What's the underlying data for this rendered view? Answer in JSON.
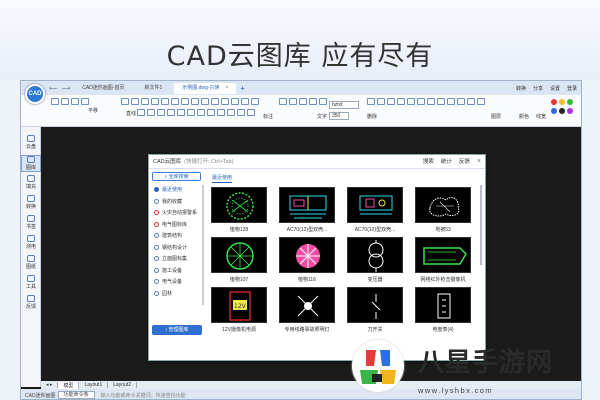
{
  "headline": "CAD云图库  应有尽有",
  "app": {
    "logo": "CAD",
    "tabs": [
      {
        "label": "CAD迷你画图-首页",
        "active": false
      },
      {
        "label": "新文件1",
        "active": false
      },
      {
        "label": "示例图.dwg-只读",
        "active": true
      }
    ],
    "add_tab": "+",
    "topright": [
      "转换",
      "分享",
      "设置",
      "登录"
    ],
    "ribbon": {
      "groups": [
        "平移",
        "直线",
        "标注",
        "文字",
        "删除",
        "图层",
        "颜色",
        "线宽"
      ],
      "font_value": "hztxt",
      "size_value": "350"
    },
    "leftbar": [
      {
        "label": "云盘",
        "active": false
      },
      {
        "label": "图库",
        "active": true
      },
      {
        "label": "填充",
        "active": false
      },
      {
        "label": "转换",
        "active": false
      },
      {
        "label": "书签",
        "active": false
      },
      {
        "label": "测电",
        "active": false
      },
      {
        "label": "图纸",
        "active": false
      },
      {
        "label": "工具",
        "active": false
      },
      {
        "label": "反馈",
        "active": false
      }
    ],
    "layout_tabs": [
      {
        "label": "模型",
        "active": true
      },
      {
        "label": "Layout1",
        "active": false
      },
      {
        "label": "Layout2",
        "active": false
      }
    ],
    "status": {
      "app_name": "CAD迷你画图",
      "cmd_button": "功能命令条",
      "hint": "输入功能或命令关键词，快速查找功能"
    }
  },
  "dialog": {
    "title": "CAD云图库",
    "subtitle": "(快捷打开: Ctrl+Tab)",
    "tools": [
      "搜索",
      "统计",
      "反馈"
    ],
    "search_button": "全库搜索",
    "recent_tab": "最近使用",
    "categories": [
      {
        "label": "最近使用",
        "active": true,
        "red": false
      },
      {
        "label": "我的收藏",
        "active": false,
        "red": false
      },
      {
        "label": "火灾自动报警系",
        "active": false,
        "red": true
      },
      {
        "label": "电气图标库",
        "active": false,
        "red": true
      },
      {
        "label": "建筑结构",
        "active": false,
        "red": false
      },
      {
        "label": "钢结构设计",
        "active": false,
        "red": false
      },
      {
        "label": "立面图标集",
        "active": false,
        "red": false
      },
      {
        "label": "施工设备",
        "active": false,
        "red": false
      },
      {
        "label": "电气设备",
        "active": false,
        "red": false
      },
      {
        "label": "园林",
        "active": false,
        "red": false
      }
    ],
    "manage_button": "管理图库",
    "items": [
      {
        "caption": "植物128",
        "icon": "plant-icon"
      },
      {
        "caption": "AC70(12)型双壳...",
        "icon": "conveyor-icon"
      },
      {
        "caption": "AC70(12)型双壳...",
        "icon": "conveyor-icon"
      },
      {
        "caption": "地被53",
        "icon": "groundcover-icon"
      },
      {
        "caption": "植物107",
        "icon": "plant-icon"
      },
      {
        "caption": "植物116",
        "icon": "flower-icon"
      },
      {
        "caption": "变压器",
        "icon": "transformer-icon"
      },
      {
        "caption": "网络红外枪击摄像机",
        "icon": "camera-icon"
      },
      {
        "caption": "12V摄像机电源",
        "icon": "power-icon"
      },
      {
        "caption": "专用线路事故照明灯",
        "icon": "lamp-icon"
      },
      {
        "caption": "刀开关",
        "icon": "switch-icon"
      },
      {
        "caption": "电度表(4)",
        "icon": "meter-icon"
      }
    ]
  },
  "watermark": {
    "title": "八星手游网",
    "url": "www.lyshbx.com"
  },
  "colors": {
    "accent": "#2a63b3",
    "canvas": "#1b1b1b",
    "thumb_green": "#3adf4c",
    "thumb_cyan": "#2fd8e8",
    "thumb_pink": "#f24da2"
  }
}
